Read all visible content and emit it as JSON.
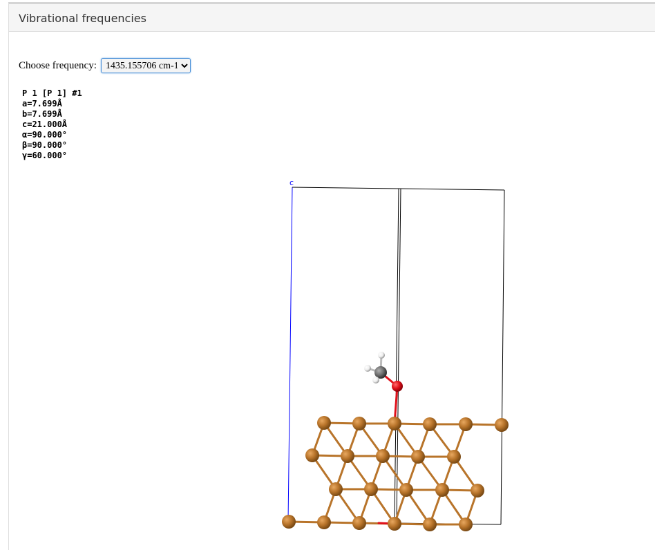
{
  "panel": {
    "title": "Vibrational frequencies"
  },
  "frequency_chooser": {
    "label": "Choose frequency:",
    "selected": "1435.155706 cm-1"
  },
  "cell": {
    "space_group": "P 1 [P 1] #1",
    "a": "a=7.699Å",
    "b": "b=7.699Å",
    "c": "c=21.000Å",
    "alpha": "α=90.000°",
    "beta": "β=90.000°",
    "gamma": "γ=60.000°",
    "axis_label_c": "c"
  },
  "colors": {
    "copper": "#b8742a",
    "oxygen": "#e0101a",
    "carbon": "#707070",
    "hydrogen": "#f0f0f0",
    "axis_c": "#0000ff"
  }
}
